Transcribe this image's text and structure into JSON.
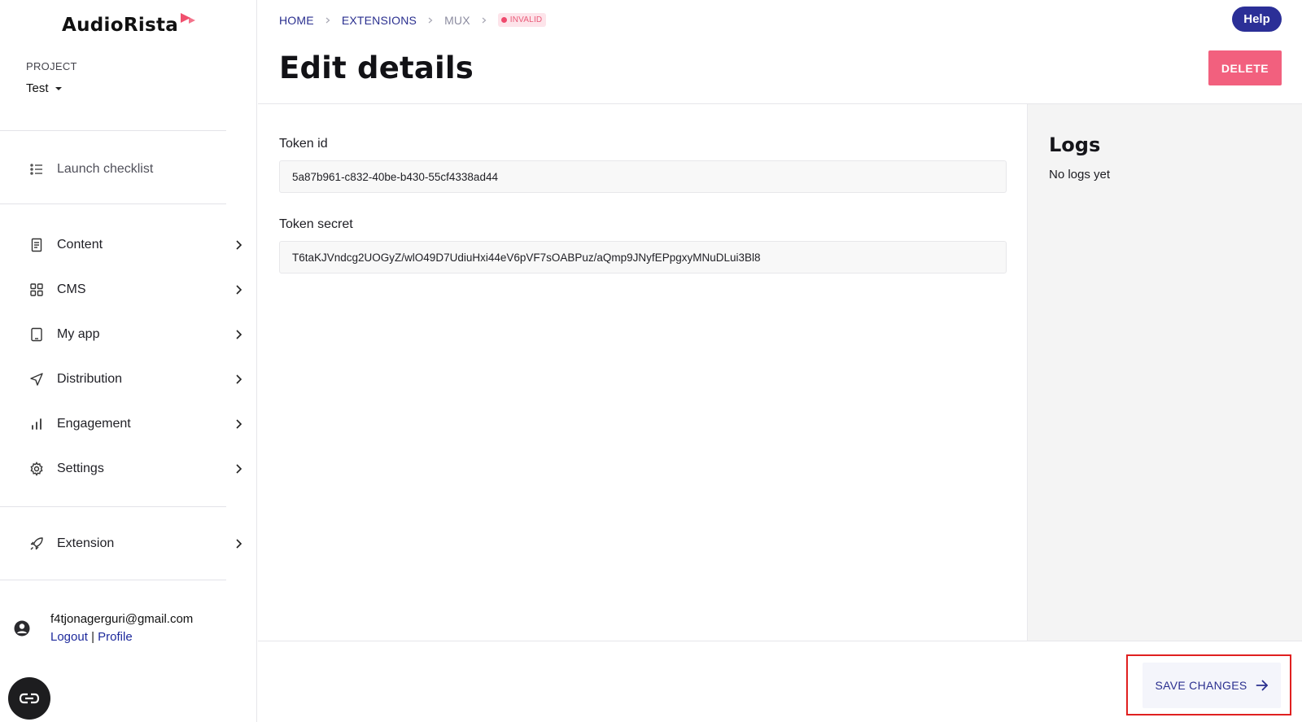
{
  "brand": {
    "name": "AudioRista",
    "accent": "#f0506e"
  },
  "project": {
    "label": "PROJECT",
    "selected": "Test"
  },
  "sidebar": {
    "items": [
      {
        "label": "Launch checklist",
        "icon": "checklist-icon"
      },
      {
        "label": "Content",
        "icon": "document-icon"
      },
      {
        "label": "CMS",
        "icon": "grid-icon"
      },
      {
        "label": "My app",
        "icon": "tablet-icon"
      },
      {
        "label": "Distribution",
        "icon": "send-icon"
      },
      {
        "label": "Engagement",
        "icon": "bar-chart-icon"
      },
      {
        "label": "Settings",
        "icon": "gear-icon"
      },
      {
        "label": "Extension",
        "icon": "rocket-icon"
      }
    ]
  },
  "user": {
    "email": "f4tjonagerguri@gmail.com",
    "logout_label": "Logout",
    "separator": "|",
    "profile_label": "Profile"
  },
  "breadcrumb": {
    "items": [
      "HOME",
      "EXTENSIONS",
      "MUX"
    ],
    "status": "INVALID"
  },
  "header": {
    "help_label": "Help",
    "title": "Edit details",
    "delete_label": "DELETE"
  },
  "form": {
    "token_id": {
      "label": "Token id",
      "value": "5a87b961-c832-40be-b430-55cf4338ad44"
    },
    "token_secret": {
      "label": "Token secret",
      "value": "T6taKJVndcg2UOGyZ/wlO49D7UdiuHxi44eV6pVF7sOABPuz/aQmp9JNyfEPpgxyMNuDLui3Bl8"
    }
  },
  "logs": {
    "title": "Logs",
    "empty_text": "No logs yet"
  },
  "footer": {
    "save_label": "SAVE CHANGES"
  },
  "colors": {
    "primary": "#2b2f97",
    "danger": "#f2607e",
    "status_invalid": "#ef4a6d",
    "highlight": "#e02020"
  }
}
